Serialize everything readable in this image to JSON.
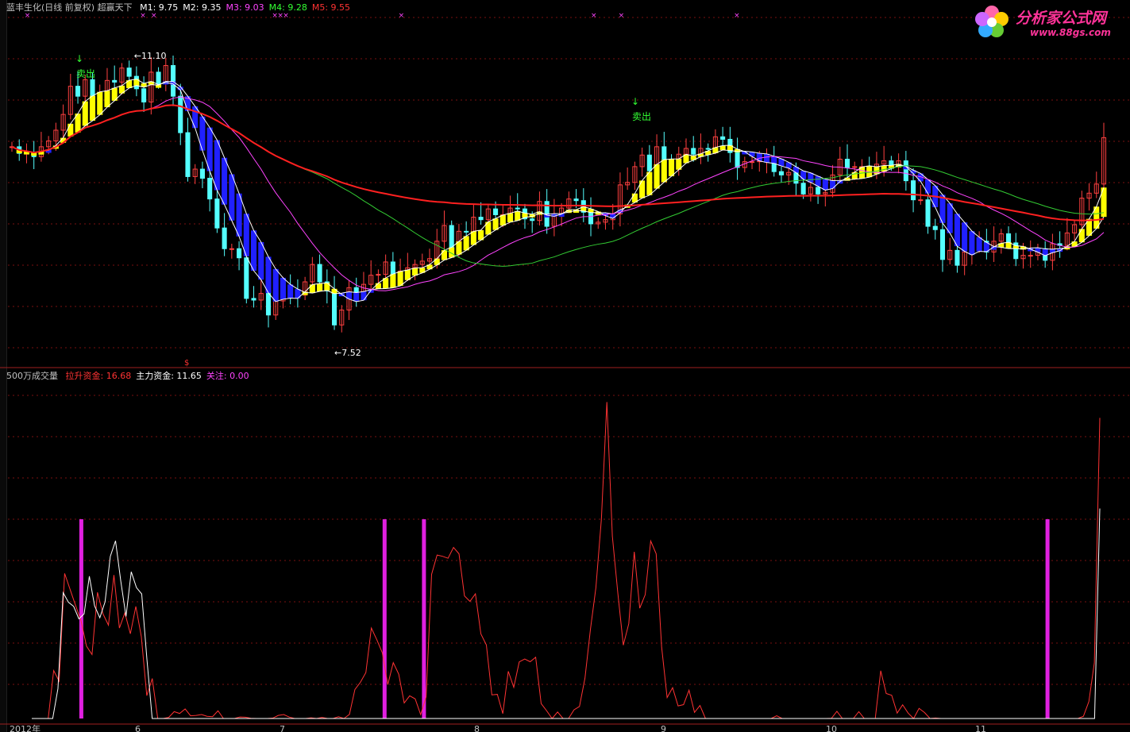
{
  "header": {
    "title": "蓝丰生化(日线 前复权) 超赢天下",
    "ma": [
      {
        "label": "M1:",
        "value": "9.75",
        "color": "#ffffff"
      },
      {
        "label": "M2:",
        "value": "9.35",
        "color": "#ffffff"
      },
      {
        "label": "M3:",
        "value": "9.03",
        "color": "#ff44ff"
      },
      {
        "label": "M4:",
        "value": "9.28",
        "color": "#33ff33"
      },
      {
        "label": "M5:",
        "value": "9.55",
        "color": "#ff3333"
      }
    ]
  },
  "logo": {
    "name": "分析家公式网",
    "url": "www.88gs.com"
  },
  "price_labels": {
    "high": "11.10",
    "low": "7.52"
  },
  "signals": [
    "卖出",
    "卖出"
  ],
  "sub_header": {
    "name": "500万成交量",
    "items": [
      {
        "label": "拉升资金:",
        "value": "16.68",
        "color": "#ff3333"
      },
      {
        "label": "主力资金:",
        "value": "11.65",
        "color": "#ffffff"
      },
      {
        "label": "关注:",
        "value": "0.00",
        "color": "#ff44ff"
      }
    ]
  },
  "x_labels": [
    "2012年",
    "6",
    "7",
    "8",
    "9",
    "10",
    "11"
  ],
  "chart_data": {
    "type": "line",
    "upper_panel": {
      "type": "candlestick",
      "ylim": [
        7.3,
        11.4
      ],
      "close": [
        9.84,
        9.76,
        9.76,
        9.72,
        9.84,
        9.91,
        10.04,
        10.23,
        10.57,
        10.45,
        10.65,
        10.37,
        10.47,
        10.64,
        10.62,
        10.79,
        10.69,
        10.54,
        10.38,
        10.74,
        10.6,
        10.82,
        10.45,
        10.01,
        9.48,
        9.57,
        9.46,
        9.21,
        8.86,
        8.61,
        8.61,
        8.5,
        8.01,
        7.99,
        8.07,
        7.81,
        7.98,
        8.15,
        8.06,
        8.05,
        8.21,
        8.42,
        8.21,
        8.1,
        7.69,
        7.87,
        8.14,
        8.06,
        8.18,
        8.29,
        8.3,
        8.45,
        8.3,
        8.34,
        8.38,
        8.42,
        8.46,
        8.49,
        8.7,
        8.89,
        8.59,
        8.82,
        8.81,
        8.99,
        8.96,
        9.09,
        9.02,
        9.02,
        9.1,
        9.09,
        8.97,
        8.95,
        9.18,
        8.88,
        9.03,
        9.1,
        9.21,
        9.19,
        9.05,
        8.91,
        8.93,
        8.96,
        9.03,
        9.38,
        9.41,
        9.6,
        9.74,
        9.55,
        9.84,
        9.69,
        9.64,
        9.75,
        9.82,
        9.75,
        9.82,
        9.81,
        9.96,
        9.93,
        9.77,
        9.59,
        9.66,
        9.66,
        9.67,
        9.67,
        9.54,
        9.5,
        9.53,
        9.4,
        9.27,
        9.35,
        9.27,
        9.29,
        9.5,
        9.69,
        9.59,
        9.6,
        9.6,
        9.57,
        9.63,
        9.67,
        9.61,
        9.67,
        9.43,
        9.2,
        9.2,
        8.88,
        8.84,
        8.48,
        8.59,
        8.41,
        8.57,
        8.62,
        8.7,
        8.57,
        8.7,
        8.79,
        8.68,
        8.49,
        8.53,
        8.53,
        8.61,
        8.47,
        8.67,
        8.65,
        8.8,
        8.9,
        9.22,
        9.28,
        9.39,
        9.95
      ]
    },
    "lower_panel": {
      "ylim": [
        0,
        18.5
      ],
      "series": [
        {
          "name": "拉升资金",
          "color": "#ff3333",
          "values": [
            0.0,
            0.0,
            0.0,
            0.0,
            2.66,
            2.07,
            8.05,
            7.16,
            6.27,
            5.41,
            4.01,
            3.55,
            7.0,
            5.81,
            5.18,
            7.96,
            5.02,
            5.86,
            4.7,
            6.22,
            4.55,
            1.27,
            2.22,
            0.0,
            0.0,
            0.06,
            0.38,
            0.28,
            0.53,
            0.15,
            0.17,
            0.22,
            0.12,
            0.1,
            0.43,
            0.0,
            0.0,
            0.0,
            0.08,
            0.07,
            0.01,
            0.0,
            0.0,
            0.0,
            0.02,
            0.17,
            0.22,
            0.08,
            0.0,
            0.0,
            0.0,
            0.04,
            0.0,
            0.06,
            0.0,
            0.0,
            0.1,
            0.0,
            0.23,
            1.61,
            2.01,
            2.55,
            5.02,
            4.37,
            3.65,
            1.88,
            3.1,
            2.46,
            0.86,
            1.26,
            1.09,
            0.22,
            1.2,
            8.0,
            9.07,
            9.0,
            8.89,
            9.49,
            9.14,
            6.8,
            6.5,
            6.92,
            4.69,
            4.08,
            1.31,
            1.34,
            0.27,
            2.62,
            1.73,
            3.14,
            3.3,
            3.15,
            3.4,
            0.83,
            0.43,
            0.0,
            0.36,
            0.0,
            0.0,
            0.48,
            0.67,
            2.24,
            4.95,
            7.27,
            11.07,
            17.56,
            10.12,
            6.96,
            4.07,
            5.26,
            9.25,
            6.12,
            6.87,
            9.85,
            9.14,
            3.96,
            1.16,
            1.71,
            0.7,
            0.77,
            1.57,
            0.34,
            0.72,
            0.0,
            0.0,
            0.0,
            0.0,
            0.0,
            0.0,
            0.0,
            0.0,
            0.0,
            0.0,
            0.0,
            0.0,
            0.0,
            0.15,
            0.0,
            0.0,
            0.0,
            0.0,
            0.0,
            0.0,
            0.0,
            0.0,
            0.0,
            0.01,
            0.4,
            0.0,
            0.0,
            0.0,
            0.38,
            0.0,
            0.0,
            0.0,
            2.65,
            1.39,
            1.29,
            0.3,
            0.76,
            0.3,
            0.0,
            0.56,
            0.33,
            0.0,
            0.03,
            0.0,
            0.0,
            0.0,
            0.0,
            0.0,
            0.0,
            0.0,
            0.0,
            0.0,
            0.0,
            0.0,
            0.0,
            0.0,
            0.0,
            0.0,
            0.0,
            0.0,
            0.0,
            0.0,
            0.0,
            0.0,
            0.0,
            0.0,
            0.0,
            0.0,
            0.0,
            0.12,
            0.94,
            3.09,
            16.68
          ]
        },
        {
          "name": "主力资金",
          "color": "#ffffff",
          "values": [
            0.0,
            0.0,
            0.0,
            0.0,
            0.0,
            1.66,
            6.98,
            6.45,
            6.22,
            5.53,
            5.81,
            7.89,
            6.25,
            5.59,
            6.47,
            8.99,
            9.86,
            7.63,
            5.66,
            8.14,
            7.26,
            6.91,
            3.27,
            0.0,
            0.0,
            0.0,
            0.0,
            0.0,
            0.0,
            0.0,
            0.0,
            0.0,
            0.0,
            0.0,
            0.0,
            0.0,
            0.0,
            0.0,
            0.0,
            0.0,
            0.0,
            0.0,
            0.0,
            0.0,
            0.0,
            0.0,
            0.0,
            0.0,
            0.0,
            0.0,
            0.0,
            0.0,
            0.0,
            0.0,
            0.0,
            0.0,
            0.0,
            0.0,
            0.0,
            0.0,
            0.0,
            0.0,
            0.0,
            0.0,
            0.0,
            0.0,
            0.0,
            0.0,
            0.0,
            0.0,
            0.0,
            0.0,
            0.0,
            0.0,
            0.0,
            0.0,
            0.0,
            0.0,
            0.0,
            0.0,
            0.0,
            0.0,
            0.0,
            0.0,
            0.0,
            0.0,
            0.0,
            0.0,
            0.0,
            0.0,
            0.0,
            0.0,
            0.0,
            0.0,
            0.0,
            0.0,
            0.0,
            0.0,
            0.0,
            0.0,
            0.0,
            0.0,
            0.0,
            0.0,
            0.0,
            0.0,
            0.0,
            0.0,
            0.0,
            0.0,
            0.0,
            0.0,
            0.0,
            0.0,
            0.0,
            0.0,
            0.0,
            0.0,
            0.0,
            0.0,
            0.0,
            0.0,
            0.0,
            0.0,
            0.0,
            0.0,
            0.0,
            0.0,
            0.0,
            0.0,
            0.0,
            0.0,
            0.0,
            0.0,
            0.0,
            0.0,
            0.0,
            0.0,
            0.0,
            0.0,
            0.0,
            0.0,
            0.0,
            0.0,
            0.0,
            0.0,
            0.0,
            0.0,
            0.0,
            0.0,
            0.0,
            0.0,
            0.0,
            0.0,
            0.0,
            0.0,
            0.0,
            0.0,
            0.0,
            0.0,
            0.0,
            0.0,
            0.0,
            0.0,
            0.0,
            0.0,
            0.0,
            0.0,
            0.0,
            0.0,
            0.0,
            0.0,
            0.0,
            0.0,
            0.0,
            0.0,
            0.0,
            0.0,
            0.0,
            0.0,
            0.0,
            0.0,
            0.0,
            0.0,
            0.0,
            0.0,
            0.0,
            0.0,
            0.0,
            0.0,
            0.0,
            0.0,
            0.0,
            0.0,
            0.0,
            0.0,
            0.0,
            0.0,
            0.0,
            0.0,
            0.0,
            0.0,
            0.0,
            0.0,
            11.65
          ]
        }
      ],
      "bars_magenta_at": [
        0.035,
        0.32,
        0.357,
        0.943
      ]
    }
  }
}
